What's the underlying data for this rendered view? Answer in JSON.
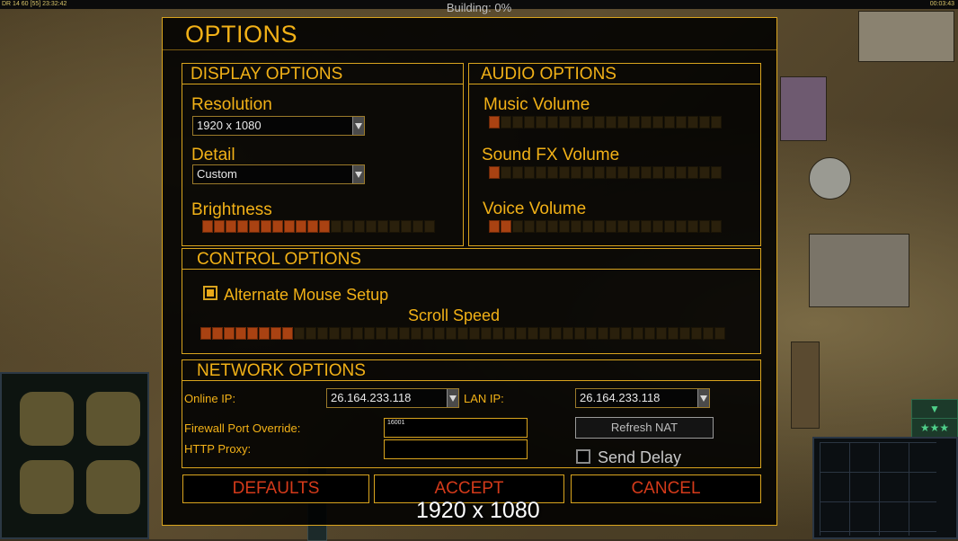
{
  "hud": {
    "top_left": "DR 14 60 [55] 23:32:42",
    "top_center": "Building: 0%",
    "top_right": "00:03:43"
  },
  "dialog": {
    "title": "OPTIONS",
    "display": {
      "title": "DISPLAY OPTIONS",
      "resolution_label": "Resolution",
      "resolution_value": "1920 x 1080",
      "detail_label": "Detail",
      "detail_value": "Custom",
      "brightness_label": "Brightness",
      "brightness_level": 0.55
    },
    "audio": {
      "title": "AUDIO OPTIONS",
      "music_label": "Music Volume",
      "music_level": 0.05,
      "sfx_label": "Sound FX Volume",
      "sfx_level": 0.05,
      "voice_label": "Voice Volume",
      "voice_level": 0.1
    },
    "control": {
      "title": "CONTROL OPTIONS",
      "alt_mouse_label": "Alternate Mouse Setup",
      "alt_mouse_checked": true,
      "scroll_label": "Scroll Speed",
      "scroll_level": 0.17
    },
    "network": {
      "title": "NETWORK OPTIONS",
      "online_ip_label": "Online IP:",
      "online_ip_value": "26.164.233.118",
      "lan_ip_label": "LAN IP:",
      "lan_ip_value": "26.164.233.118",
      "firewall_label": "Firewall Port Override:",
      "firewall_value": "16001",
      "proxy_label": "HTTP Proxy:",
      "proxy_value": "",
      "refresh_label": "Refresh NAT",
      "send_delay_label": "Send Delay",
      "send_delay_checked": false
    },
    "buttons": {
      "defaults": "DEFAULTS",
      "accept": "ACCEPT",
      "cancel": "CANCEL"
    },
    "footer_overlay": "1920 x 1080"
  }
}
